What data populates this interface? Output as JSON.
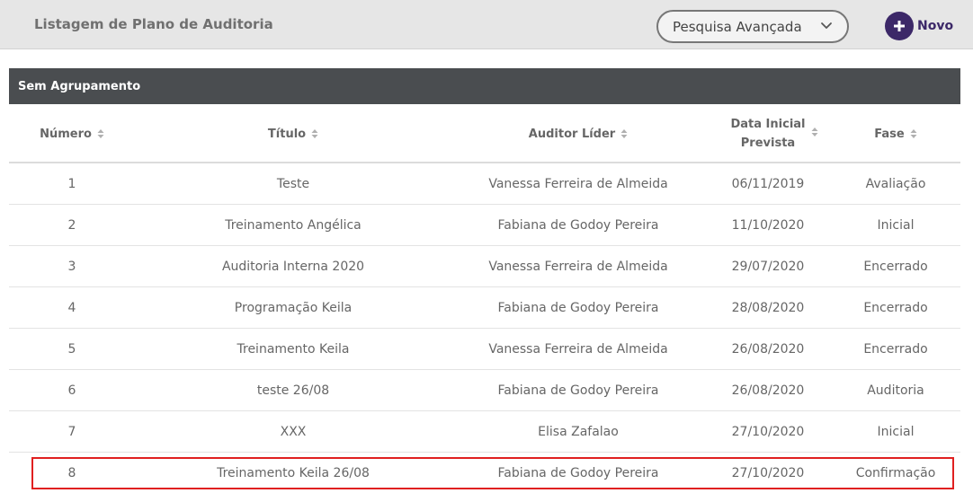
{
  "header": {
    "title": "Listagem de Plano de Auditoria",
    "advanced_search_label": "Pesquisa Avançada",
    "new_label": "Novo"
  },
  "group": {
    "label": "Sem Agrupamento"
  },
  "table": {
    "columns": [
      "Número",
      "Título",
      "Auditor Líder",
      "Data Inicial\nPrevista",
      "Fase"
    ],
    "rows": [
      {
        "numero": "1",
        "titulo": "Teste",
        "auditor": "Vanessa Ferreira de Almeida",
        "data": "06/11/2019",
        "fase": "Avaliação"
      },
      {
        "numero": "2",
        "titulo": "Treinamento Angélica",
        "auditor": "Fabiana de Godoy Pereira",
        "data": "11/10/2020",
        "fase": "Inicial"
      },
      {
        "numero": "3",
        "titulo": "Auditoria Interna 2020",
        "auditor": "Vanessa Ferreira de Almeida",
        "data": "29/07/2020",
        "fase": "Encerrado"
      },
      {
        "numero": "4",
        "titulo": "Programação Keila",
        "auditor": "Fabiana de Godoy Pereira",
        "data": "28/08/2020",
        "fase": "Encerrado"
      },
      {
        "numero": "5",
        "titulo": "Treinamento Keila",
        "auditor": "Vanessa Ferreira de Almeida",
        "data": "26/08/2020",
        "fase": "Encerrado"
      },
      {
        "numero": "6",
        "titulo": "teste 26/08",
        "auditor": "Fabiana de Godoy Pereira",
        "data": "26/08/2020",
        "fase": "Auditoria"
      },
      {
        "numero": "7",
        "titulo": "XXX",
        "auditor": "Elisa Zafalao",
        "data": "27/10/2020",
        "fase": "Inicial"
      },
      {
        "numero": "8",
        "titulo": "Treinamento Keila 26/08",
        "auditor": "Fabiana de Godoy Pereira",
        "data": "27/10/2020",
        "fase": "Confirmação"
      }
    ],
    "highlighted_row_index": 7
  },
  "colors": {
    "accent": "#3c2868",
    "group_header_bg": "#4a4d50",
    "highlight_border": "#e02020",
    "topbar_bg": "#e6e6e6"
  }
}
